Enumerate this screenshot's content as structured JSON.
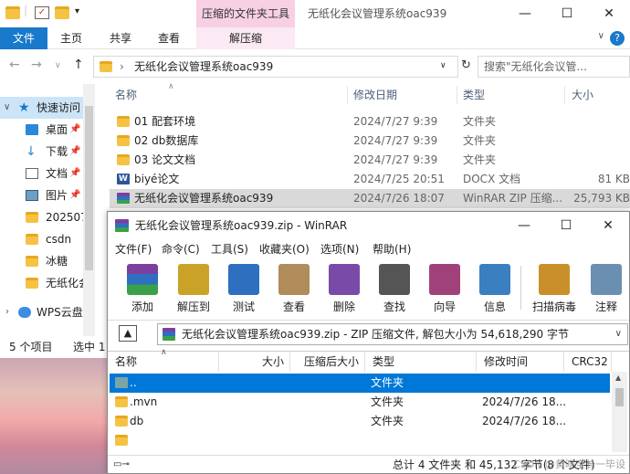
{
  "explorer": {
    "ribbon_context_title": "压缩的文件夹工具",
    "window_title": "无纸化会议管理系统oac939",
    "tabs": [
      "文件",
      "主页",
      "共享",
      "查看",
      "解压缩"
    ],
    "address_path": "无纸化会议管理系统oac939",
    "search_placeholder": "搜索\"无纸化会议管...",
    "nav_items": [
      {
        "label": "快速访问",
        "icon": "star-icon"
      },
      {
        "label": "桌面",
        "icon": "desktop-icon"
      },
      {
        "label": "下载",
        "icon": "download-icon"
      },
      {
        "label": "文档",
        "icon": "document-icon"
      },
      {
        "label": "图片",
        "icon": "picture-icon"
      },
      {
        "label": "202507",
        "icon": "folder-icon"
      },
      {
        "label": "csdn",
        "icon": "folder-icon"
      },
      {
        "label": "冰糖",
        "icon": "folder-icon"
      },
      {
        "label": "无纸化会",
        "icon": "folder-icon"
      },
      {
        "label": "WPS云盘",
        "icon": "cloud-icon"
      }
    ],
    "columns": {
      "name": "名称",
      "date": "修改日期",
      "type": "类型",
      "size": "大小"
    },
    "files": [
      {
        "name": "01 配套环境",
        "date": "2024/7/27 9:39",
        "type": "文件夹",
        "size": "",
        "icon": "folder-icon"
      },
      {
        "name": "02 db数据库",
        "date": "2024/7/27 9:39",
        "type": "文件夹",
        "size": "",
        "icon": "folder-icon"
      },
      {
        "name": "03 论文文档",
        "date": "2024/7/27 9:39",
        "type": "文件夹",
        "size": "",
        "icon": "folder-icon"
      },
      {
        "name": "biyé论文",
        "date": "2024/7/25 20:51",
        "type": "DOCX 文档",
        "size": "81 KB",
        "icon": "word-icon"
      },
      {
        "name": "无纸化会议管理系统oac939",
        "date": "2024/7/26 18:07",
        "type": "WinRAR ZIP 压缩...",
        "size": "25,793 KB",
        "icon": "winrar-icon"
      }
    ],
    "status_count": "5 个项目",
    "status_selected": "选中 1"
  },
  "winrar": {
    "title": "无纸化会议管理系统oac939.zip - WinRAR",
    "menus": [
      "文件(F)",
      "命令(C)",
      "工具(S)",
      "收藏夹(O)",
      "选项(N)",
      "帮助(H)"
    ],
    "tools": [
      {
        "label": "添加",
        "icon": "add-icon",
        "color": "#8a5a2b"
      },
      {
        "label": "解压到",
        "icon": "extract-icon",
        "color": "#c9a227"
      },
      {
        "label": "测试",
        "icon": "test-icon",
        "color": "#2e6fc0"
      },
      {
        "label": "查看",
        "icon": "view-icon",
        "color": "#b08c5a"
      },
      {
        "label": "删除",
        "icon": "delete-icon",
        "color": "#7a4aa8"
      },
      {
        "label": "查找",
        "icon": "find-icon",
        "color": "#555555"
      },
      {
        "label": "向导",
        "icon": "wizard-icon",
        "color": "#a0427a"
      },
      {
        "label": "信息",
        "icon": "info-icon",
        "color": "#3a7fc0"
      },
      {
        "label": "扫描病毒",
        "icon": "virus-scan-icon",
        "color": "#c98f2a"
      },
      {
        "label": "注释",
        "icon": "comment-icon",
        "color": "#6a8fb0"
      }
    ],
    "archive_info": "无纸化会议管理系统oac939.zip - ZIP 压缩文件, 解包大小为 54,618,290 字节",
    "columns": {
      "name": "名称",
      "size": "大小",
      "packed": "压缩后大小",
      "type": "类型",
      "modified": "修改时间",
      "crc": "CRC32"
    },
    "rows": [
      {
        "name": "..",
        "type": "文件夹",
        "modified": ""
      },
      {
        "name": ".mvn",
        "type": "文件夹",
        "modified": "2024/7/26 18..."
      },
      {
        "name": "db",
        "type": "文件夹",
        "modified": "2024/7/26 18..."
      },
      {
        "name": "",
        "type": "",
        "modified": ""
      }
    ],
    "status_summary": "总计 4 文件夹 和 45,132 字节(8 个文件)",
    "watermark": "CSDN @黄晓宝长一毕设"
  }
}
